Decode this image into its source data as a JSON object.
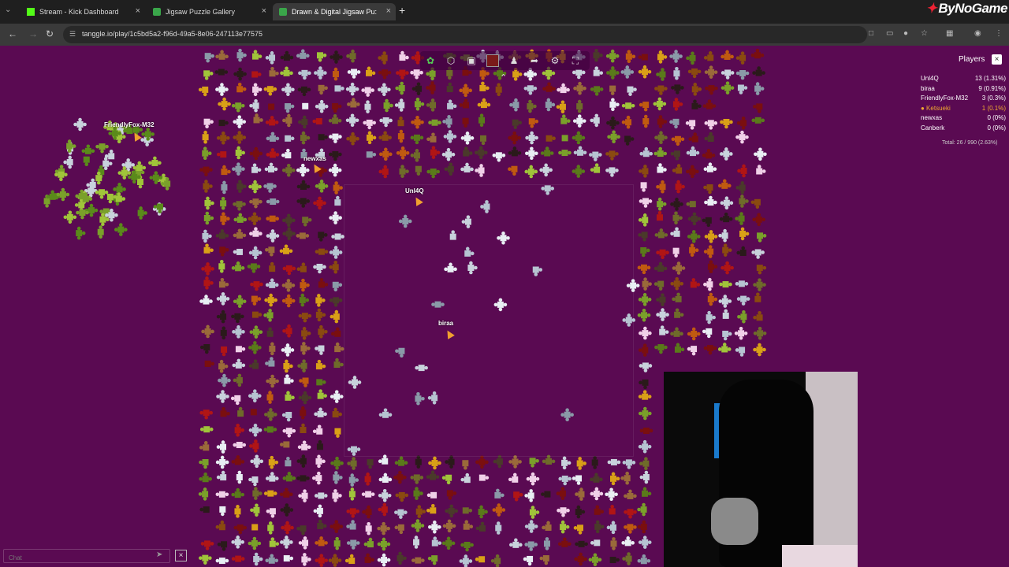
{
  "tabs": [
    {
      "label": "Stream - Kick Dashboard",
      "icon": "kick-icon",
      "active": false
    },
    {
      "label": "Jigsaw Puzzle Gallery",
      "icon": "tanggle-icon",
      "active": false
    },
    {
      "label": "Drawn & Digital Jigsaw Pu:",
      "icon": "tanggle-icon",
      "active": true
    }
  ],
  "brand": {
    "name": "ByNoGame"
  },
  "address": {
    "url": "tanggle.io/play/1c5bd5a2-f96d-49a5-8e06-247113e77575"
  },
  "toolbar": {
    "buttons": [
      "leaf-icon",
      "shape-icon",
      "preview-icon",
      "color-swatch",
      "players-icon",
      "share-icon",
      "settings-icon",
      "fullscreen-icon"
    ],
    "color": "#7a1a1a"
  },
  "cursors": [
    {
      "name": "FriendlyFox-M32"
    },
    {
      "name": "newxas"
    },
    {
      "name": "Unl4Q"
    },
    {
      "name": "biraa"
    }
  ],
  "players": {
    "title": "Players",
    "list": [
      {
        "name": "Unl4Q",
        "score": "13 (1.31%)",
        "highlight": false
      },
      {
        "name": "biraa",
        "score": "9 (0.91%)",
        "highlight": false
      },
      {
        "name": "FriendlyFox-M32",
        "score": "3 (0.3%)",
        "highlight": false
      },
      {
        "name": "Ketsueki",
        "score": "1 (0.1%)",
        "highlight": true
      },
      {
        "name": "newxas",
        "score": "0 (0%)",
        "highlight": false
      },
      {
        "name": "Canberk",
        "score": "0 (0%)",
        "highlight": false
      }
    ],
    "total": "Total: 26 / 990 (2.63%)"
  },
  "chat": {
    "placeholder": "Chat"
  },
  "colors": {
    "background": "#5a0a52",
    "highlight": "#f0a830"
  }
}
